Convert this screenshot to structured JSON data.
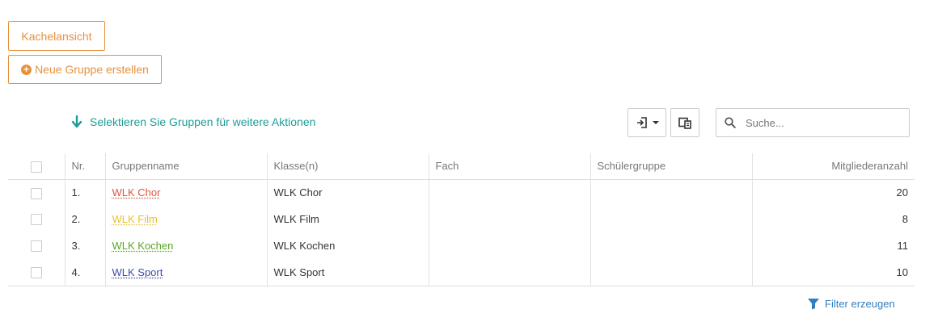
{
  "toolbar": {
    "tile_view_label": "Kachelansicht",
    "new_group_label": "Neue Gruppe erstellen",
    "select_hint": "Selektieren Sie Gruppen für weitere Aktionen",
    "search_placeholder": "Suche..."
  },
  "table": {
    "headers": {
      "nr": "Nr.",
      "name": "Gruppenname",
      "classes": "Klasse(n)",
      "subject": "Fach",
      "pupil_group": "Schülergruppe",
      "members": "Mitgliederanzahl"
    },
    "rows": [
      {
        "nr": "1.",
        "name": "WLK Chor",
        "name_color": "#e0553f",
        "classes": "WLK Chor",
        "subject": "",
        "pupil_group": "",
        "members": "20"
      },
      {
        "nr": "2.",
        "name": "WLK Film",
        "name_color": "#e8c229",
        "classes": "WLK Film",
        "subject": "",
        "pupil_group": "",
        "members": "8"
      },
      {
        "nr": "3.",
        "name": "WLK Kochen",
        "name_color": "#5aa627",
        "classes": "WLK Kochen",
        "subject": "",
        "pupil_group": "",
        "members": "11"
      },
      {
        "nr": "4.",
        "name": "WLK Sport",
        "name_color": "#3a4ea8",
        "classes": "WLK Sport",
        "subject": "",
        "pupil_group": "",
        "members": "10"
      }
    ]
  },
  "footer": {
    "filter_label": "Filter erzeugen"
  },
  "colors": {
    "accent_orange": "#e8913c",
    "hint_teal": "#1b9e95",
    "link_blue": "#2f7fc1"
  },
  "icons": {
    "new_group": "plus-circle-icon",
    "hint": "arrow-down-icon",
    "import": "sign-in-icon",
    "export": "export-device-icon",
    "search": "search-icon",
    "filter": "filter-icon"
  }
}
